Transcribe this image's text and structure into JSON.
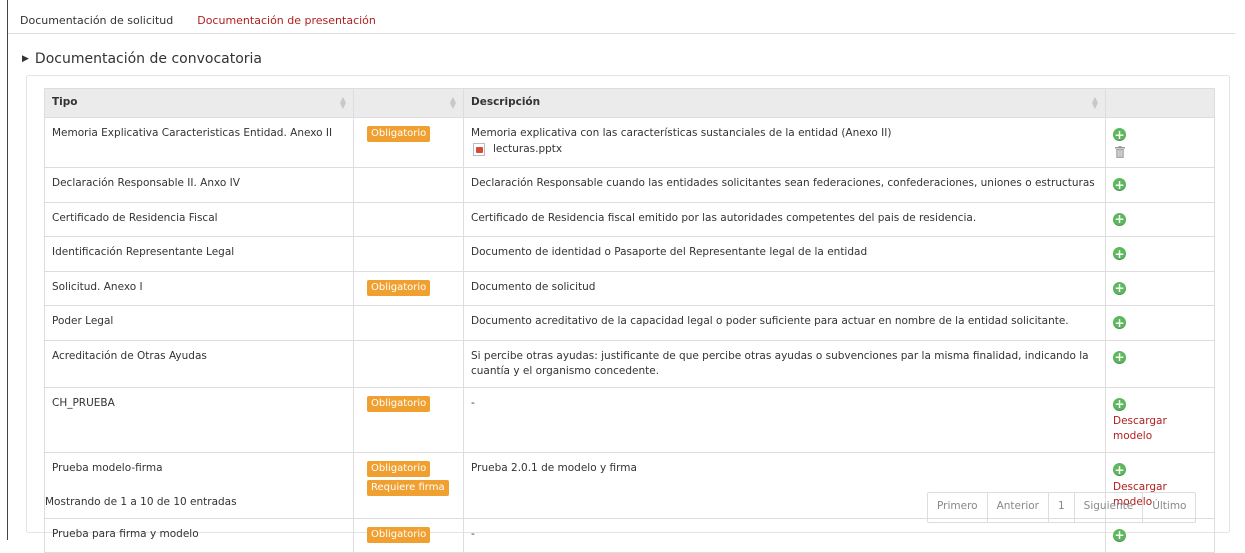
{
  "tabs": {
    "solicitud": "Documentación de solicitud",
    "presentacion": "Documentación de presentación"
  },
  "section_title": "Documentación de convocatoria",
  "columns": {
    "tipo": "Tipo",
    "estado": "",
    "descripcion": "Descripción",
    "acciones": ""
  },
  "rows": [
    {
      "tipo": "Memoria Explicativa Caracteristicas Entidad. Anexo II",
      "badges": [
        "Obligatorio"
      ],
      "descripcion": "Memoria explicativa con las características sustanciales de la entidad (Anexo II)",
      "file": "lecturas.pptx",
      "has_delete": true,
      "download": ""
    },
    {
      "tipo": "Declaración Responsable II. Anxo IV",
      "badges": [],
      "descripcion": "Declaración Responsable cuando las entidades solicitantes sean federaciones, confederaciones, uniones o estructuras",
      "file": "",
      "has_delete": false,
      "download": ""
    },
    {
      "tipo": "Certificado de Residencia Fiscal",
      "badges": [],
      "descripcion": "Certificado de Residencia fiscal emitido por las autoridades competentes del pais de residencia.",
      "file": "",
      "has_delete": false,
      "download": ""
    },
    {
      "tipo": "Identificación Representante Legal",
      "badges": [],
      "descripcion": "Documento de identidad o Pasaporte del Representante legal de la entidad",
      "file": "",
      "has_delete": false,
      "download": ""
    },
    {
      "tipo": "Solicitud. Anexo I",
      "badges": [
        "Obligatorio"
      ],
      "descripcion": "Documento de solicitud",
      "file": "",
      "has_delete": false,
      "download": ""
    },
    {
      "tipo": "Poder Legal",
      "badges": [],
      "descripcion": "Documento acreditativo de la capacidad legal o poder suficiente para actuar en nombre de la entidad solicitante.",
      "file": "",
      "has_delete": false,
      "download": ""
    },
    {
      "tipo": "Acreditación de Otras Ayudas",
      "badges": [],
      "descripcion": "Si percibe otras ayudas: justificante de que percibe otras ayudas o subvenciones par la misma finalidad, indicando la cuantía y el organismo concedente.",
      "file": "",
      "has_delete": false,
      "download": ""
    },
    {
      "tipo": "CH_PRUEBA",
      "badges": [
        "Obligatorio"
      ],
      "descripcion": "-",
      "file": "",
      "has_delete": false,
      "download": "Descargar modelo"
    },
    {
      "tipo": "Prueba modelo-firma",
      "badges": [
        "Obligatorio",
        "Requiere firma"
      ],
      "descripcion": "Prueba 2.0.1 de modelo y firma",
      "file": "",
      "has_delete": false,
      "download": "Descargar modelo"
    },
    {
      "tipo": "Prueba para firma y modelo",
      "badges": [
        "Obligatorio"
      ],
      "descripcion": "-",
      "file": "",
      "has_delete": false,
      "download": ""
    }
  ],
  "footer_info": "Mostrando de 1 a 10 de 10 entradas",
  "pagination": {
    "first": "Primero",
    "prev": "Anterior",
    "page": "1",
    "next": "Siguiente",
    "last": "Último"
  },
  "colors": {
    "badge": "#f0a030",
    "plus": "#5cb85c",
    "link": "#b02020"
  }
}
